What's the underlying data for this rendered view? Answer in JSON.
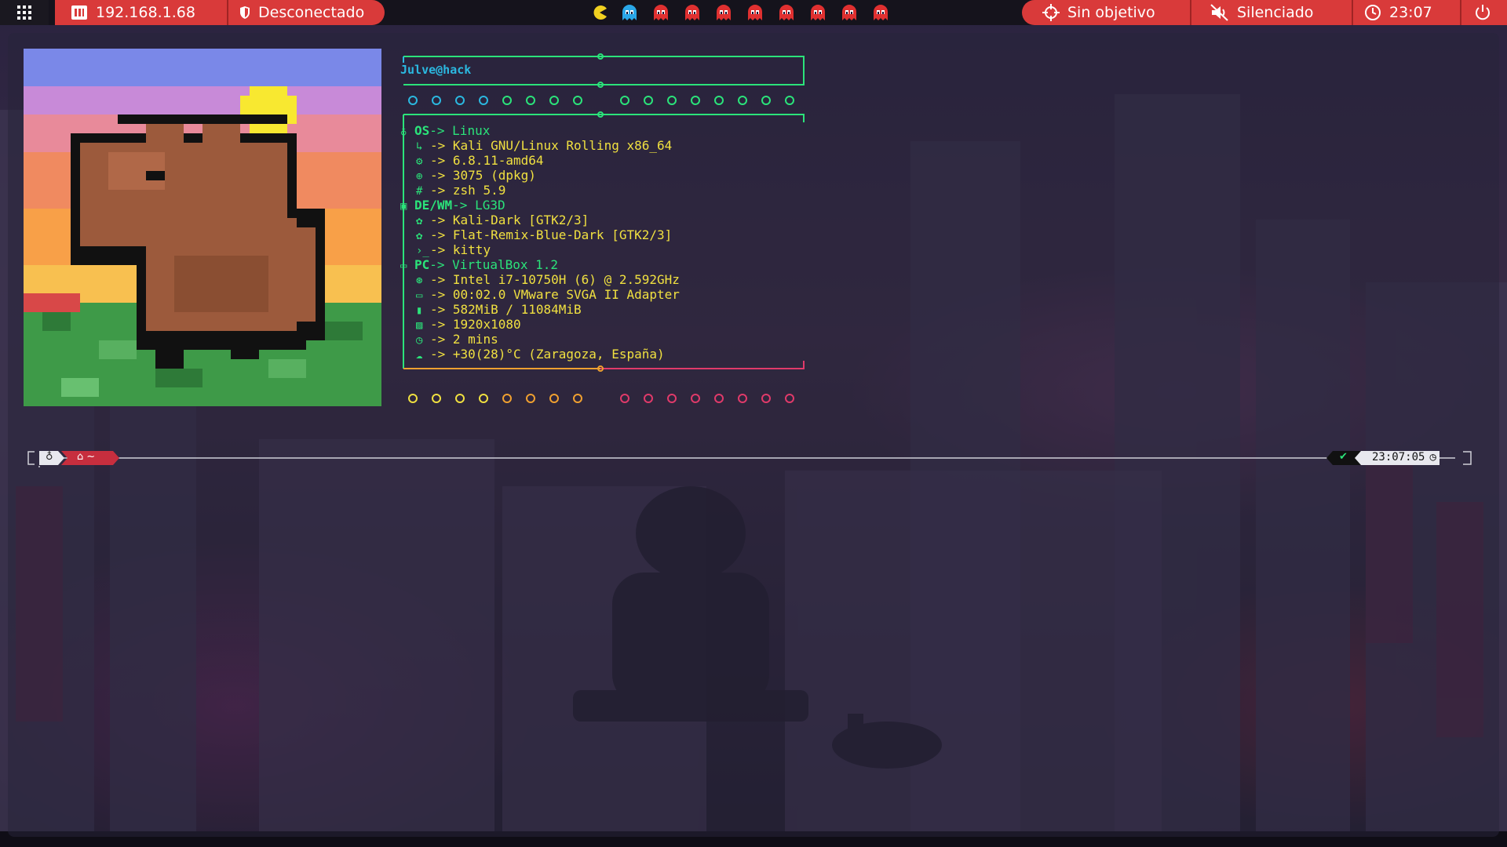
{
  "topbar": {
    "ip": "192.168.1.68",
    "vpn": "Desconectado",
    "target": "Sin objetivo",
    "volume": "Silenciado",
    "clock": "23:07",
    "icons": [
      "apps-grid-icon",
      "network-icon",
      "shield-icon",
      "pacman-icon",
      "ghost-icon",
      "crosshair-icon",
      "mute-icon",
      "clock-icon",
      "power-icon"
    ],
    "ghost_count": 9
  },
  "fetch": {
    "user": "Julve@hack",
    "os_header": "OS",
    "os_value": "Linux",
    "lines_os": [
      {
        "icon": "kali-icon",
        "text": "Kali GNU/Linux Rolling x86_64"
      },
      {
        "icon": "gear-icon",
        "text": "6.8.11-amd64"
      },
      {
        "icon": "package-icon",
        "text": "3075 (dpkg)"
      },
      {
        "icon": "hash-icon",
        "text": "zsh 5.9"
      }
    ],
    "de_header": "DE/WM",
    "de_value": "LG3D",
    "lines_de": [
      {
        "icon": "palette-icon",
        "text": "Kali-Dark [GTK2/3]"
      },
      {
        "icon": "palette-icon",
        "text": "Flat-Remix-Blue-Dark [GTK2/3]"
      },
      {
        "icon": "terminal-icon",
        "text": "kitty"
      }
    ],
    "pc_header": "PC",
    "pc_value": "VirtualBox 1.2",
    "lines_pc": [
      {
        "icon": "cpu-icon",
        "text": "Intel i7-10750H (6) @ 2.592GHz"
      },
      {
        "icon": "monitor-icon",
        "text": "00:02.0 VMware SVGA II Adapter"
      },
      {
        "icon": "memory-icon",
        "text": "582MiB / 11084MiB"
      },
      {
        "icon": "image-icon",
        "text": "1920x1080"
      },
      {
        "icon": "clock-icon",
        "text": "2 mins"
      },
      {
        "icon": "weather-icon",
        "text": "+30(28)°C (Zaragoza, España)"
      }
    ],
    "arrow": "->"
  },
  "prompt": {
    "os_glyph": "kali-icon",
    "home_glyph": "home-icon",
    "path": "~",
    "status": "✔",
    "time": "23:07:05"
  },
  "colors": {
    "red_accent": "#d93a3a",
    "green": "#2be37a",
    "cyan": "#2bb8e0",
    "yellow": "#f0e040",
    "orange": "#f0a030",
    "pink": "#e03a6a"
  }
}
